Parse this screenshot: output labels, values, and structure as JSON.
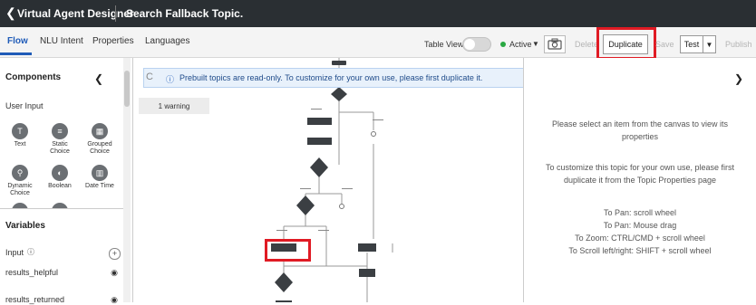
{
  "header": {
    "app_title": "Virtual Agent Designer",
    "topic_title": "Search Fallback Topic."
  },
  "tabs": [
    "Flow",
    "NLU Intent",
    "Properties",
    "Languages"
  ],
  "toolbar": {
    "table_view_label": "Table View",
    "status_label": "Active",
    "delete_label": "Delete",
    "duplicate_label": "Duplicate",
    "save_label": "Save",
    "test_label": "Test",
    "publish_label": "Publish",
    "status_color": "#2aa843",
    "highlight_color": "#e01b24"
  },
  "left_panel": {
    "components_title": "Components",
    "user_input_label": "User Input",
    "components": [
      {
        "label": "Text",
        "icon": "text-input-icon"
      },
      {
        "label": "Static Choice",
        "icon": "list-icon"
      },
      {
        "label": "Grouped Choice",
        "icon": "grid-icon"
      },
      {
        "label": "Dynamic Choice",
        "icon": "search-icon"
      },
      {
        "label": "Boolean",
        "icon": "toggle-icon"
      },
      {
        "label": "Date Time",
        "icon": "calendar-icon"
      }
    ],
    "variables_title": "Variables",
    "input_label": "Input",
    "variables": [
      "results_helpful",
      "results_returned"
    ]
  },
  "canvas": {
    "banner_text": "Prebuilt topics are read-only. To customize for your own use, please first duplicate it.",
    "warning_label": "1 warning"
  },
  "right_panel": {
    "select_msg": "Please select an item from the canvas to view its properties",
    "customize_msg": "To customize this topic for your own use, please first duplicate it from the Topic Properties page",
    "hints": [
      "To Pan: scroll wheel",
      "To Pan: Mouse drag",
      "To Zoom: CTRL/CMD + scroll wheel",
      "To Scroll left/right: SHIFT + scroll wheel"
    ]
  }
}
